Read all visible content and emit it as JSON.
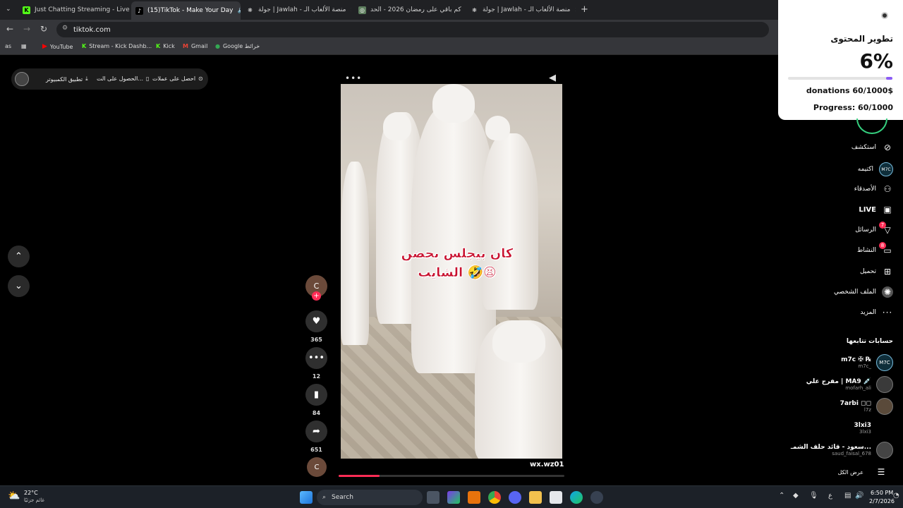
{
  "browser": {
    "tabs": [
      {
        "title": "Just Chatting Streaming - Live",
        "favicon": "kick-icon"
      },
      {
        "title": "(15)TikTok - Make Your Day",
        "favicon": "tiktok-icon",
        "active": true
      },
      {
        "title": "جولة | Jawlah - منصة الألعاب الـ",
        "favicon": "jawlah-icon"
      },
      {
        "title": "كم باقي على رمضان 2026 - الحد",
        "favicon": "globe-icon"
      },
      {
        "title": "جولة | Jawlah - منصة الألعاب الـ",
        "favicon": "jawlah-icon"
      }
    ],
    "url": "tiktok.com",
    "bookmarks": [
      "YouTube",
      "Stream - Kick Dashb...",
      "Kick",
      "Gmail",
      "Google خرائط"
    ],
    "bookmarks_left": "as"
  },
  "topbar": {
    "get_coins": "احصل على عملات",
    "get_app": "الحصول على الت...",
    "desktop_app": "تطبيق الكمبيوتر"
  },
  "video": {
    "caption_line1": "كان بيجلس بحضن",
    "caption_line2": "الشايب 🤣😫",
    "username": "wx.wz01",
    "progress_fraction": 0.18
  },
  "actions": {
    "avatar_letter": "C",
    "likes": "365",
    "comments": "12",
    "saves": "84",
    "shares": "651",
    "bottom_avatar_letter": "C"
  },
  "overlay": {
    "title": "تطوير المحتوى",
    "percent": "6%",
    "percent_fraction": 0.06,
    "donations": "donations 60/1000$",
    "progress": "Progress: 60/1000",
    "accent": "#8b5cf6"
  },
  "sidebar": {
    "items": [
      {
        "label": "استكشف",
        "icon": "compass-icon"
      },
      {
        "label": "اكتيمه",
        "icon": "m7c-avatar-icon"
      },
      {
        "label": "الأصدقاء",
        "icon": "friends-icon"
      },
      {
        "label": "LIVE",
        "icon": "live-icon"
      },
      {
        "label": "الرسائل",
        "icon": "send-icon",
        "badge": "7"
      },
      {
        "label": "النشاط",
        "icon": "message-icon",
        "badge": "8"
      },
      {
        "label": "تحميل",
        "icon": "upload-icon"
      },
      {
        "label": "الملف الشخصي",
        "icon": "profile-icon"
      },
      {
        "label": "المزيد",
        "icon": "more-icon"
      }
    ],
    "following_title": "حسابات تتابعها",
    "following": [
      {
        "name": "m7c ✠ ℞",
        "handle": "m7c_",
        "avatar": "M7C"
      },
      {
        "name": "مفرج علي | MA9 💉",
        "handle": "mofarh_ali",
        "avatar": ""
      },
      {
        "name": "7arbi ◻◻",
        "handle": "l7z",
        "avatar": ""
      },
      {
        "name": "3lxi3",
        "handle": "3lxi3",
        "avatar": ""
      },
      {
        "name": "سعود - قائد حلف الشمـ...",
        "handle": "saud_faisal_678",
        "avatar": ""
      }
    ],
    "show_all": "عرض الكل"
  },
  "taskbar": {
    "weather_temp": "22°C",
    "weather_text": "غائم جزئيًا",
    "search": "Search",
    "time": "6:50 PM",
    "date": "2/7/2026",
    "lang": "ع"
  }
}
